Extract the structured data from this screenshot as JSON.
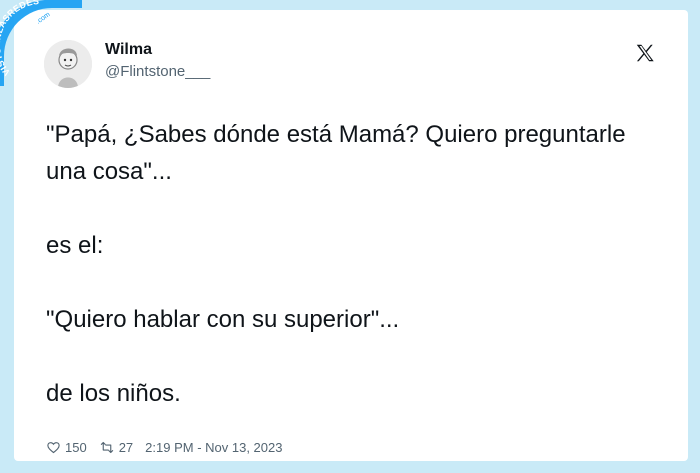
{
  "author": {
    "name": "Wilma",
    "handle": "@Flintstone___"
  },
  "tweet": {
    "lines": [
      "\"Papá, ¿Sabes dónde está Mamá? Quiero preguntarle una cosa\"...",
      "es el:",
      "\"Quiero hablar con su superior\"...",
      "de los niños."
    ]
  },
  "metrics": {
    "likes": "150",
    "retweets": "27",
    "timestamp": "2:19 PM - Nov 13, 2023"
  },
  "watermark": {
    "text": "VISTOENLASREDES",
    "suffix": ".com"
  },
  "icons": {
    "brand": "x-logo-icon",
    "like": "heart-icon",
    "retweet": "retweet-icon"
  }
}
